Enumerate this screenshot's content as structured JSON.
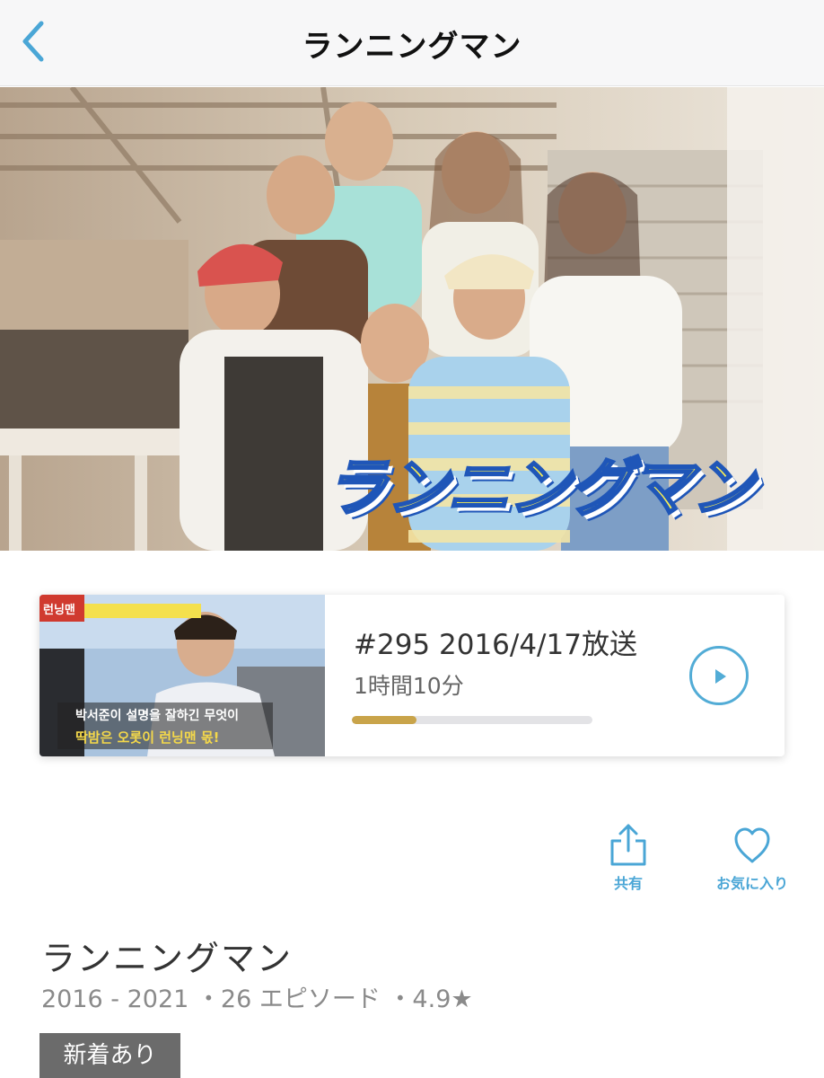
{
  "nav": {
    "title": "ランニングマン",
    "back_icon": "chevron-left-icon",
    "accent": "#4aa6d6"
  },
  "hero": {
    "logo_text": "ランニングマン"
  },
  "episode": {
    "title": "#295 2016/4/17放送",
    "duration": "1時間10分",
    "progress": 0.27,
    "progress_color": "#c9a44a",
    "play_icon": "play-icon",
    "thumbnail": {
      "title_tag": "런닝맨",
      "caption_line1": "박서준이 설명을 잘하긴 무엇이",
      "caption_line2": "딱밤은 오롯이 런닝맨 몫!"
    }
  },
  "actions": {
    "share_label": "共有",
    "share_icon": "share-icon",
    "favorite_label": "お気に入り",
    "favorite_icon": "heart-icon"
  },
  "show": {
    "title": "ランニングマン",
    "meta": "2016 - 2021 ・26 エピソード ・4.9★",
    "badge": "新着あり"
  }
}
